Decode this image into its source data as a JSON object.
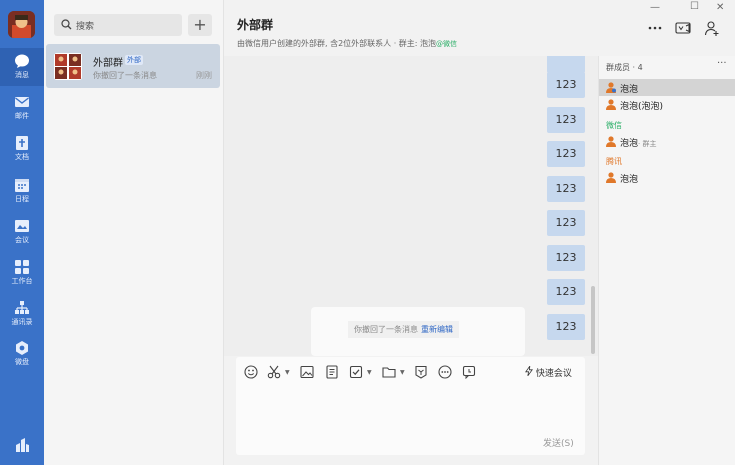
{
  "nav": {
    "items": [
      {
        "label": "消息",
        "icon": "chat-bubble-icon"
      },
      {
        "label": "邮件",
        "icon": "mail-icon"
      },
      {
        "label": "文档",
        "icon": "document-icon"
      },
      {
        "label": "日程",
        "icon": "calendar-icon"
      },
      {
        "label": "会议",
        "icon": "meeting-icon"
      },
      {
        "label": "工作台",
        "icon": "workbench-icon"
      },
      {
        "label": "通讯录",
        "icon": "contacts-icon"
      },
      {
        "label": "微盘",
        "icon": "cloud-drive-icon"
      }
    ]
  },
  "list": {
    "search_placeholder": "搜索",
    "add_label": "+",
    "conversations": [
      {
        "name": "外部群",
        "tag": "外部",
        "preview": "你撤回了一条消息",
        "time": "刚刚"
      }
    ]
  },
  "chat": {
    "title": "外部群",
    "subtitle": "由微信用户创建的外部群, 含2位外部联系人 · 群主: 泡泡",
    "subtitle_suffix": "@微信",
    "messages": [
      "123",
      "123",
      "123",
      "123",
      "123",
      "123",
      "123",
      "123"
    ],
    "recall_text": "你撤回了一条消息",
    "reedit_label": "重新编辑",
    "quick_meeting_label": "快速会议",
    "send_label": "发送(S)"
  },
  "members": {
    "header": "群成员 · 4",
    "more": "···",
    "groups": [
      {
        "label": "",
        "color": "",
        "members": [
          {
            "name": "泡泡",
            "note": ""
          },
          {
            "name": "泡泡(泡泡)",
            "note": ""
          }
        ]
      },
      {
        "label": "微信",
        "color": "#2aae67",
        "members": [
          {
            "name": "泡泡",
            "note": "· 群主"
          }
        ]
      },
      {
        "label": "腾讯",
        "color": "#e0782a",
        "members": [
          {
            "name": "泡泡",
            "note": ""
          }
        ]
      }
    ]
  },
  "colors": {
    "nav_bg": "#3a72c8",
    "bubble": "#c6d8ee",
    "link": "#2f67c5"
  }
}
